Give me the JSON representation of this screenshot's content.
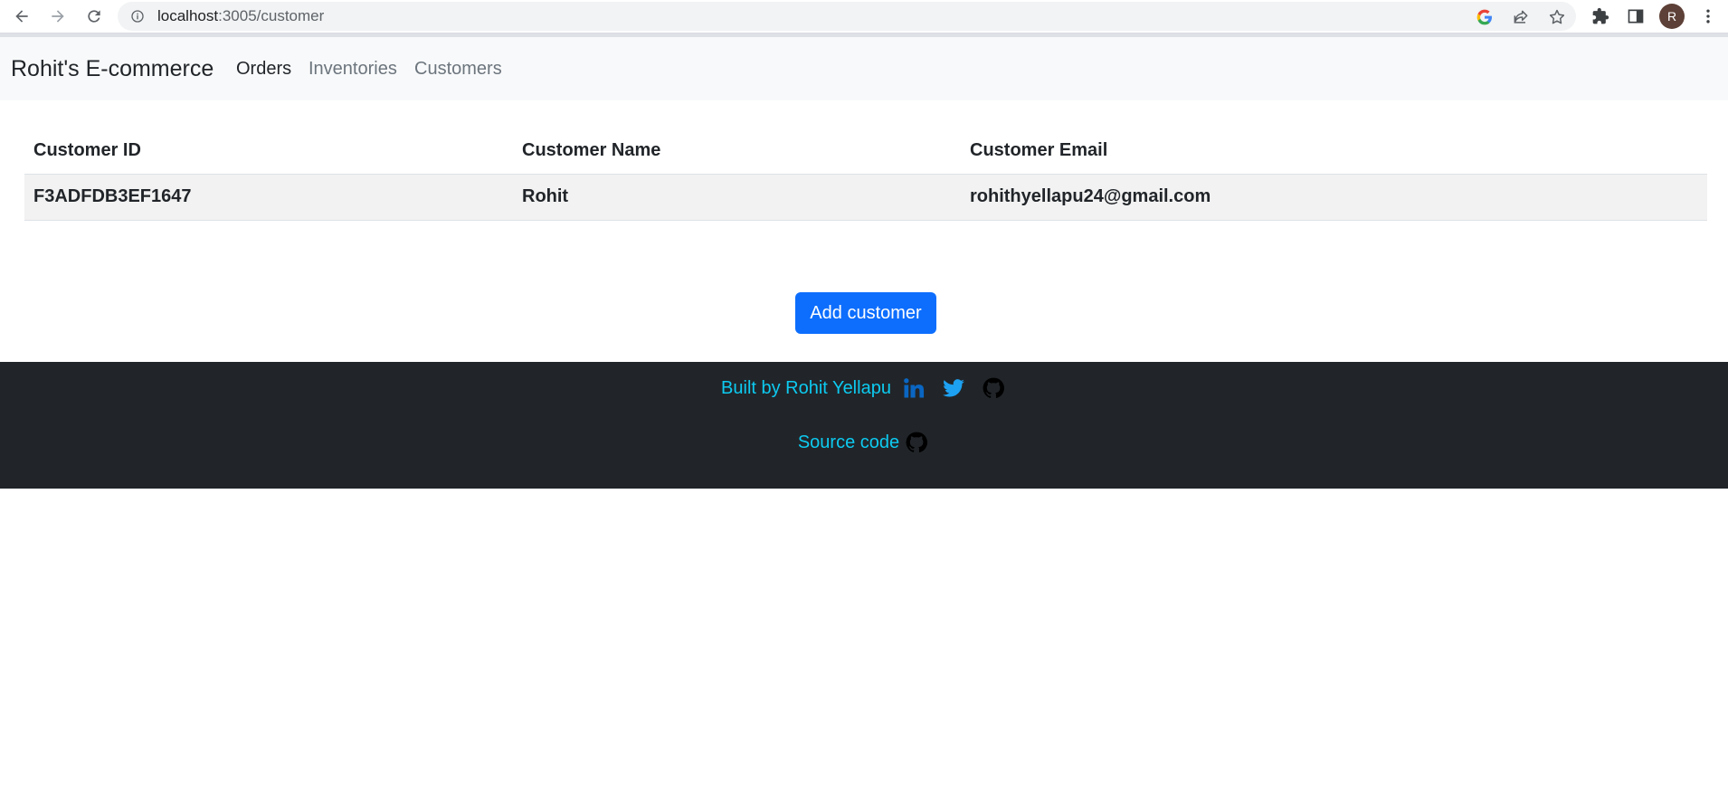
{
  "browser": {
    "url_host": "localhost",
    "url_path": ":3005/customer",
    "profile_initial": "R"
  },
  "navbar": {
    "brand": "Rohit's E-commerce",
    "links": [
      {
        "label": "Orders",
        "active": true
      },
      {
        "label": "Inventories",
        "active": false
      },
      {
        "label": "Customers",
        "active": false
      }
    ]
  },
  "table": {
    "headers": [
      "Customer ID",
      "Customer Name",
      "Customer Email"
    ],
    "rows": [
      [
        "F3ADFDB3EF1647",
        "Rohit",
        "rohithyellapu24@gmail.com"
      ]
    ]
  },
  "actions": {
    "add_label": "Add customer"
  },
  "footer": {
    "built_by": "Built by Rohit Yellapu",
    "source_code": "Source code"
  },
  "colors": {
    "primary": "#0d6efd",
    "footer_bg": "#212529",
    "footer_link": "#0dcaf0",
    "navbar_bg": "#f8f9fa",
    "linkedin": "#0a66c2",
    "twitter": "#1da1f2"
  }
}
